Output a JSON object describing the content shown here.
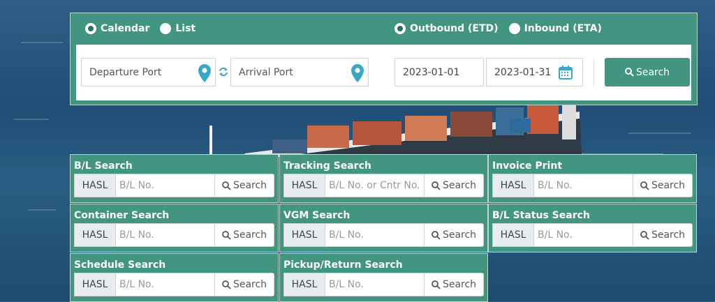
{
  "view_mode": {
    "options": [
      {
        "label": "Calendar",
        "selected": true
      },
      {
        "label": "List",
        "selected": false
      }
    ]
  },
  "direction": {
    "options": [
      {
        "label": "Outbound (ETD)",
        "selected": true
      },
      {
        "label": "Inbound (ETA)",
        "selected": false
      }
    ]
  },
  "schedule": {
    "departure_placeholder": "Departure Port",
    "arrival_placeholder": "Arrival Port",
    "date_from": "2023-01-01",
    "date_to": "2023-01-31",
    "search_label": "Search"
  },
  "cards": [
    {
      "title": "B/L Search",
      "prefix": "HASL",
      "placeholder": "B/L No.",
      "button": "Search"
    },
    {
      "title": "Tracking Search",
      "prefix": "HASL",
      "placeholder": "B/L No. or Cntr No.",
      "button": "Search"
    },
    {
      "title": "Invoice Print",
      "prefix": "HASL",
      "placeholder": "B/L No.",
      "button": "Search"
    },
    {
      "title": "Container Search",
      "prefix": "HASL",
      "placeholder": "B/L No.",
      "button": "Search"
    },
    {
      "title": "VGM Search",
      "prefix": "HASL",
      "placeholder": "B/L No.",
      "button": "Search"
    },
    {
      "title": "B/L Status Search",
      "prefix": "HASL",
      "placeholder": "B/L No.",
      "button": "Search"
    },
    {
      "title": "Schedule Search",
      "prefix": "HASL",
      "placeholder": "B/L No.",
      "button": "Search"
    },
    {
      "title": "Pickup/Return Search",
      "prefix": "HASL",
      "placeholder": "B/L No.",
      "button": "Search"
    }
  ],
  "colors": {
    "accent": "#429581",
    "pin": "#3aa7c4"
  },
  "icons": [
    "location-pin-icon",
    "swap-icon",
    "calendar-icon",
    "search-icon"
  ]
}
